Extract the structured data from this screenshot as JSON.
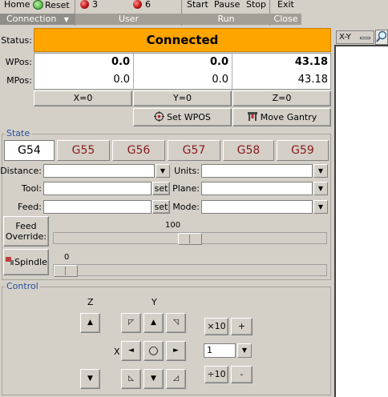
{
  "ribbon": {
    "home": "Home",
    "reset": "Reset",
    "user_count_a": "3",
    "user_count_b": "6",
    "start": "Start",
    "pause": "Pause",
    "stop": "Stop",
    "exit": "Exit",
    "group_connection": "Connection",
    "group_user": "User",
    "group_run": "Run",
    "group_close": "Close"
  },
  "view": {
    "projection": "X-Y"
  },
  "status": {
    "label": "Status:",
    "value": "Connected",
    "color": "#ffa500"
  },
  "position": {
    "wpos_label": "WPos:",
    "mpos_label": "MPos:",
    "wpos": [
      "0.0",
      "0.0",
      "43.18"
    ],
    "mpos": [
      "0.0",
      "0.0",
      "43.18"
    ]
  },
  "zero_buttons": [
    "X=0",
    "Y=0",
    "Z=0"
  ],
  "actions": {
    "set_wpos": "Set WPOS",
    "move_gantry": "Move Gantry"
  },
  "state": {
    "title": "State",
    "tabs": [
      "G54",
      "G55",
      "G56",
      "G57",
      "G58",
      "G59"
    ],
    "active_tab": "G54",
    "labels": {
      "distance": "Distance:",
      "tool": "Tool:",
      "feed": "Feed:",
      "units": "Units:",
      "plane": "Plane:",
      "mode": "Mode:"
    },
    "set_label": "set",
    "feed_override": "Feed\nOverride:",
    "feed_override_value": "100",
    "spindle": "Spindle",
    "spindle_value": "0"
  },
  "control": {
    "title": "Control",
    "z_label": "Z",
    "y_label": "Y",
    "x_label": "X",
    "x10": "×10",
    "plus": "+",
    "step_value": "1",
    "div10": "÷10",
    "minus": "-"
  }
}
